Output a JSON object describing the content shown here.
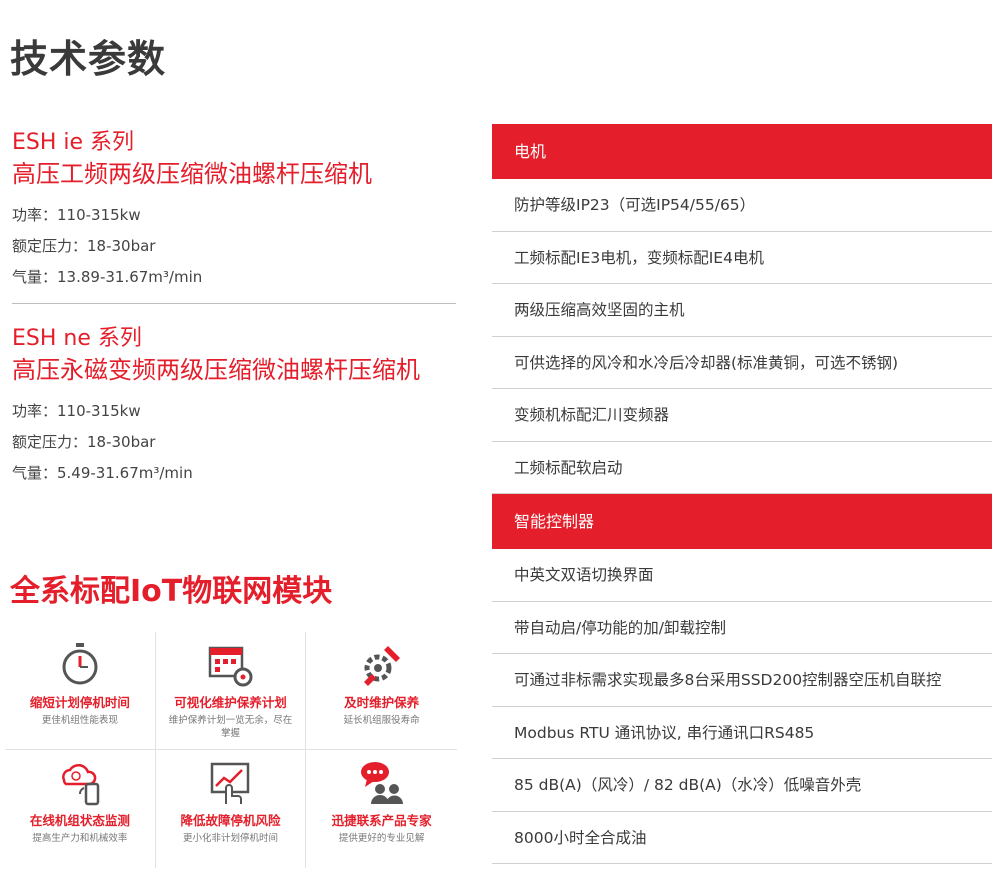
{
  "page_title": "技术参数",
  "series": [
    {
      "name": "ESH ie 系列",
      "subtitle": "高压工频两级压缩微油螺杆压缩机",
      "specs": [
        "功率：110-315kw",
        "额定压力：18-30bar",
        "气量：13.89-31.67m³/min"
      ]
    },
    {
      "name": "ESH ne 系列",
      "subtitle": "高压永磁变频两级压缩微油螺杆压缩机",
      "specs": [
        "功率：110-315kw",
        "额定压力：18-30bar",
        "气量：5.49-31.67m³/min"
      ]
    }
  ],
  "iot": {
    "title": "全系标配IoT物联网模块",
    "items": [
      {
        "label": "缩短计划停机时间",
        "desc": "更佳机组性能表现",
        "icon": "stopwatch-icon"
      },
      {
        "label": "可视化维护保养计划",
        "desc": "维护保养计划一览无余，尽在掌握",
        "icon": "calendar-gear-icon"
      },
      {
        "label": "及时维护保养",
        "desc": "延长机组服役寿命",
        "icon": "gear-wrench-icon"
      },
      {
        "label": "在线机组状态监测",
        "desc": "提高生产力和机械效率",
        "icon": "cloud-phone-icon"
      },
      {
        "label": "降低故障停机风险",
        "desc": "更小化非计划停机时间",
        "icon": "touch-chart-icon"
      },
      {
        "label": "迅捷联系产品专家",
        "desc": "提供更好的专业见解",
        "icon": "chat-people-icon"
      }
    ]
  },
  "spec_table": {
    "motor": {
      "header": "电机",
      "rows": [
        "防护等级IP23（可选IP54/55/65）",
        "工频标配IE3电机，变频标配IE4电机",
        "两级压缩高效坚固的主机",
        "可供选择的风冷和水冷后冷却器(标准黄铜，可选不锈钢)",
        "变频机标配汇川变频器",
        "工频标配软启动"
      ]
    },
    "controller": {
      "header": "智能控制器",
      "rows": [
        "中英文双语切换界面",
        "带自动启/停功能的加/卸载控制",
        "可通过非标需求实现最多8台采用SSD200控制器空压机自联控",
        "Modbus RTU 通讯协议, 串行通讯口RS485",
        "85 dB(A)（风冷）/ 82 dB(A)（水冷）低噪音外壳",
        "8000小时全合成油"
      ]
    }
  },
  "colors": {
    "accent": "#e41f2b",
    "text": "#3a3a3a",
    "divider": "#d0d0d0"
  }
}
